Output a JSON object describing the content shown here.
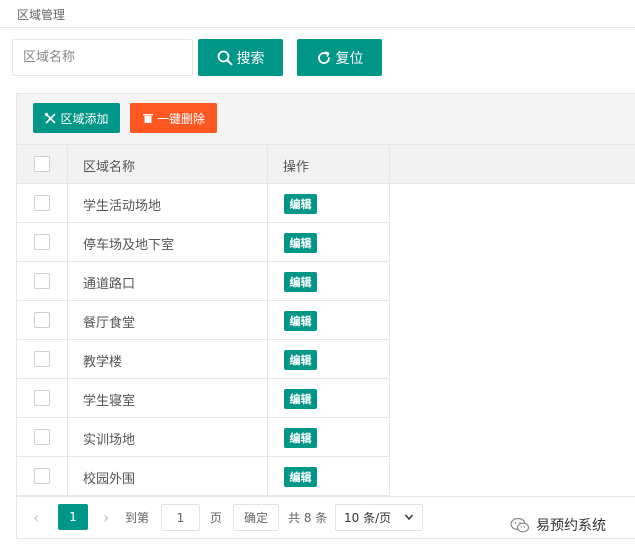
{
  "breadcrumb": "区域管理",
  "search": {
    "placeholder": "区域名称",
    "value": ""
  },
  "buttons": {
    "search": "搜索",
    "reset": "复位",
    "add": "区域添加",
    "delete": "一键删除",
    "edit": "编辑"
  },
  "table": {
    "headers": [
      "区域名称",
      "操作"
    ],
    "rows": [
      "学生活动场地",
      "停车场及地下室",
      "通道路口",
      "餐厅食堂",
      "教学楼",
      "学生寝室",
      "实训场地",
      "校园外围"
    ]
  },
  "pagination": {
    "prev": "‹",
    "next": "›",
    "current": "1",
    "goto_label": "到第",
    "goto_value": "1",
    "page_label": "页",
    "confirm": "确定",
    "total": "共 8 条",
    "page_size": "10 条/页"
  },
  "watermark": "易预约系统",
  "colors": {
    "primary": "#009688",
    "danger": "#ff5722"
  },
  "icons": {
    "search": "search-icon",
    "reset": "refresh-icon",
    "add": "tools-icon",
    "delete": "trash-icon",
    "select": "chevron-down-icon",
    "watermark": "wechat-icon"
  }
}
